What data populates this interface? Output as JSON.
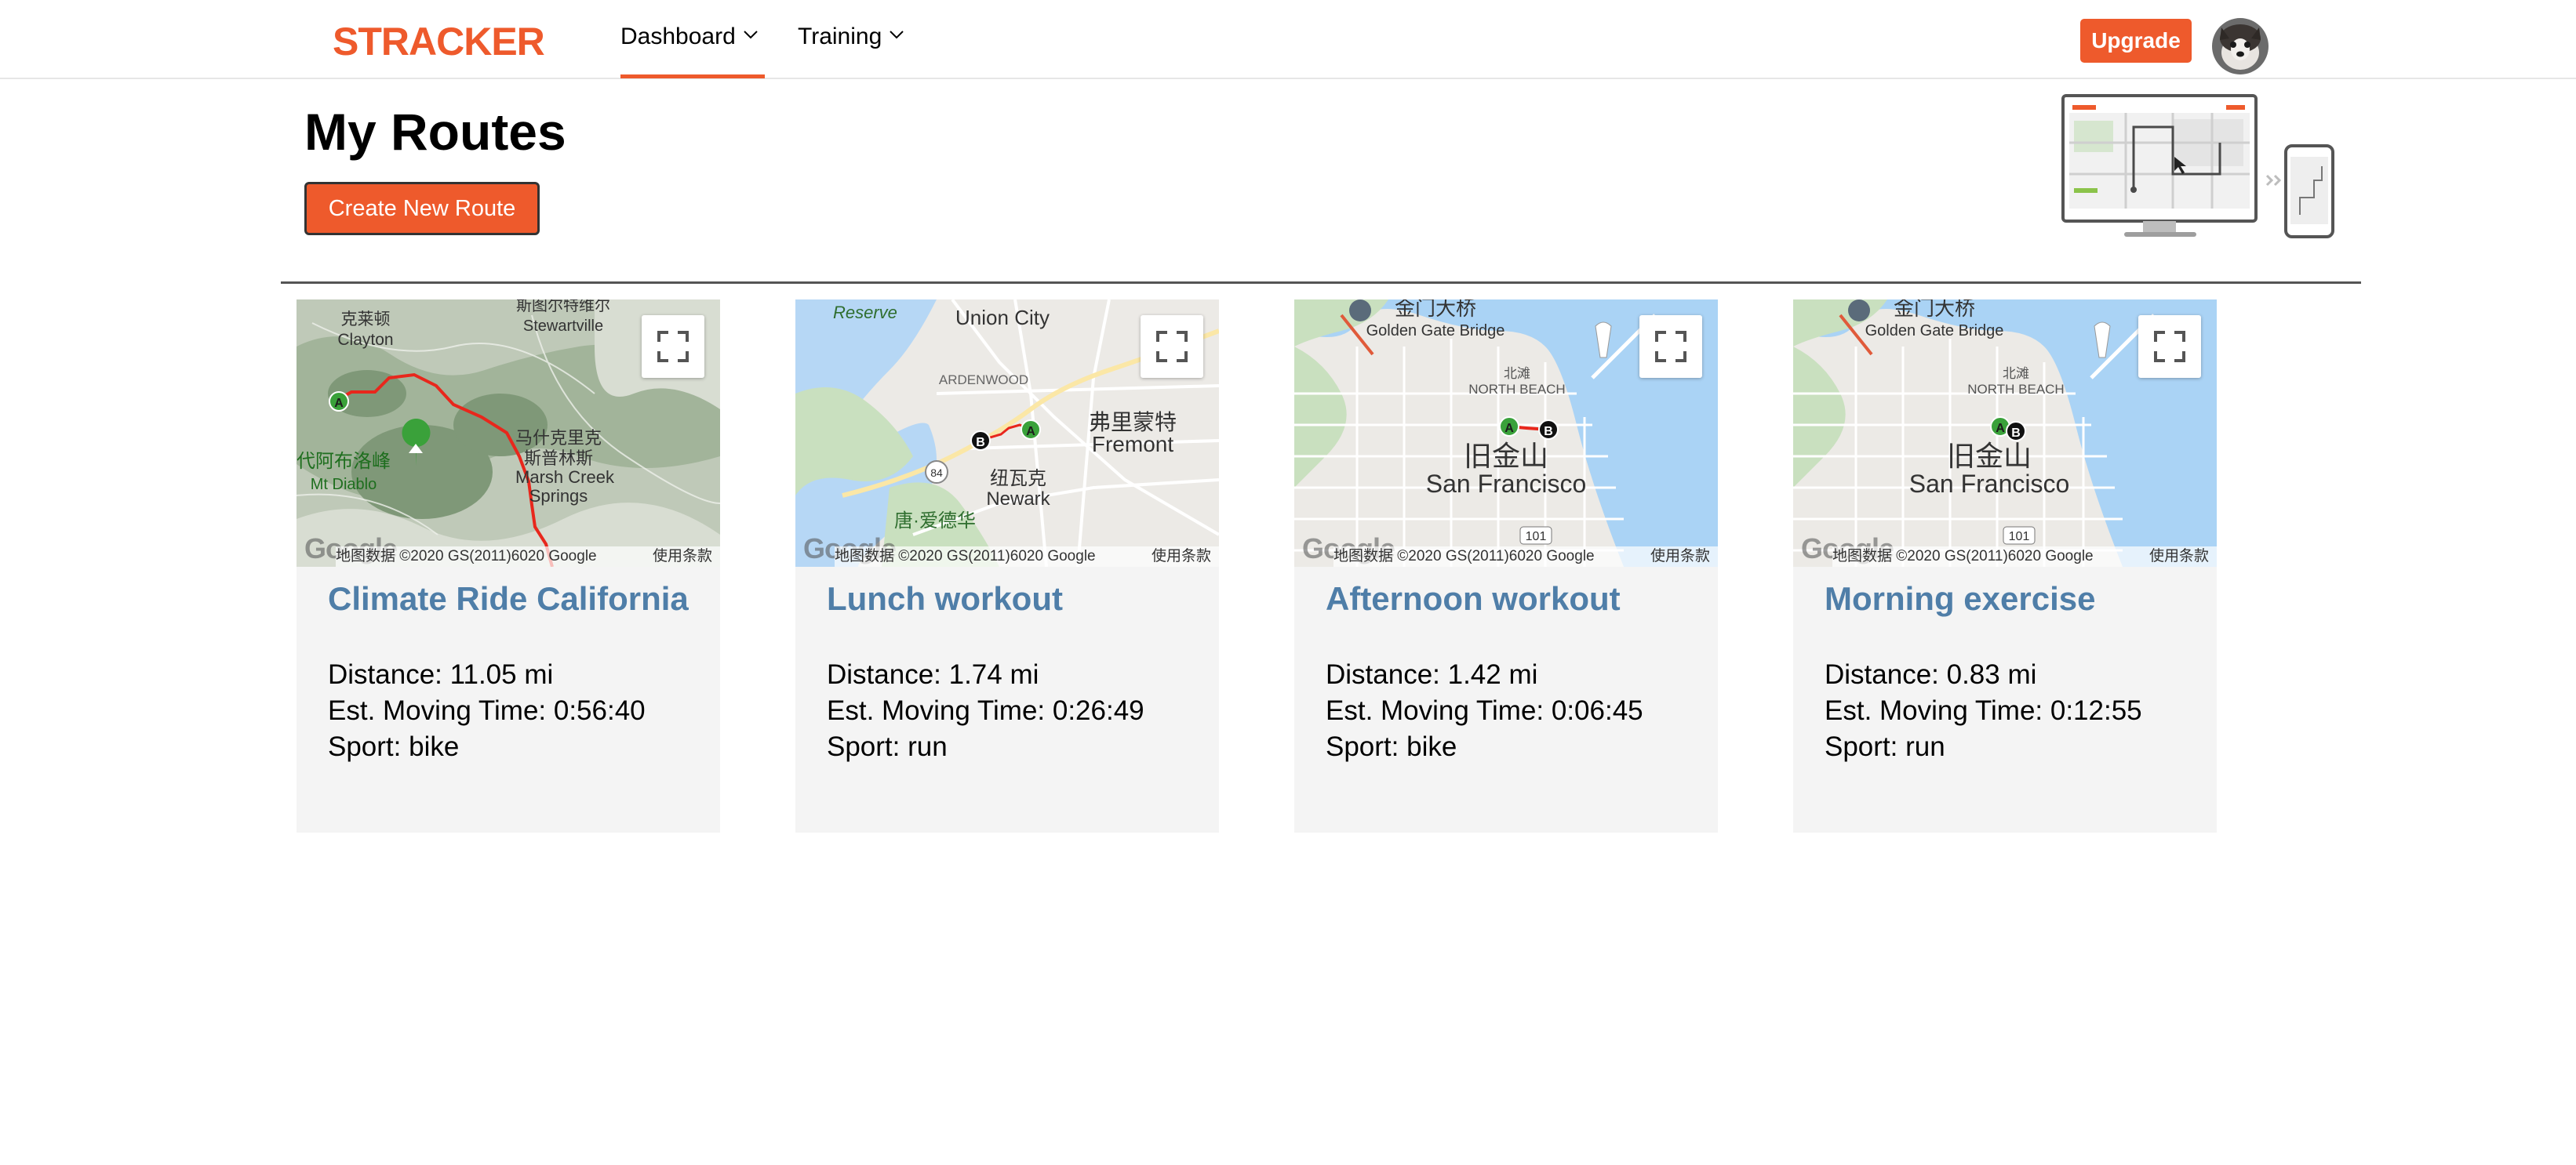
{
  "nav": {
    "logo": "STRACKER",
    "items": [
      {
        "label": "Dashboard",
        "active": true
      },
      {
        "label": "Training",
        "active": false
      }
    ],
    "upgrade_label": "Upgrade",
    "accent_color": "#ee5a2c"
  },
  "header": {
    "title": "My Routes",
    "create_button": "Create New Route"
  },
  "routes": [
    {
      "title": "Climate Ride California",
      "distance": "Distance: 11.05 mi",
      "time": "Est. Moving Time: 0:56:40",
      "sport": "Sport: bike",
      "map_attribution": "地图数据 ©2020 GS(2011)6020 Google",
      "map_terms": "使用条款",
      "map_labels": [
        "克莱顿",
        "Clayton",
        "斯图尔特维尔",
        "Stewartville",
        "代阿布洛峰",
        "Mt Diablo",
        "马什克里克",
        "斯普林斯",
        "Marsh Creek",
        "Springs"
      ]
    },
    {
      "title": "Lunch workout",
      "distance": "Distance: 1.74 mi",
      "time": "Est. Moving Time: 0:26:49",
      "sport": "Sport: run",
      "map_attribution": "地图数据 ©2020 GS(2011)6020 Google",
      "map_terms": "使用条款",
      "map_labels": [
        "Reserve",
        "Union City",
        "ARDENWOOD",
        "弗里蒙特",
        "Fremont",
        "纽瓦克",
        "Newark",
        "唐·爱德华",
        "84"
      ]
    },
    {
      "title": "Afternoon workout",
      "distance": "Distance: 1.42 mi",
      "time": "Est. Moving Time: 0:06:45",
      "sport": "Sport: bike",
      "map_attribution": "地图数据 ©2020 GS(2011)6020 Google",
      "map_terms": "使用条款",
      "map_labels": [
        "金门大桥",
        "Golden Gate Bridge",
        "北滩",
        "NORTH BEACH",
        "旧金山",
        "San Francisco",
        "101"
      ]
    },
    {
      "title": "Morning exercise",
      "distance": "Distance: 0.83 mi",
      "time": "Est. Moving Time: 0:12:55",
      "sport": "Sport: run",
      "map_attribution": "地图数据 ©2020 GS(2011)6020 Google",
      "map_terms": "使用条款",
      "map_labels": [
        "金门大桥",
        "Golden Gate Bridge",
        "北滩",
        "NORTH BEACH",
        "旧金山",
        "San Francisco",
        "101"
      ]
    }
  ],
  "icons": {
    "nav_chevron": "chevron-down-icon",
    "fullscreen": "fullscreen-icon",
    "start_marker": "A",
    "end_marker": "B",
    "map_logo": "Google"
  }
}
